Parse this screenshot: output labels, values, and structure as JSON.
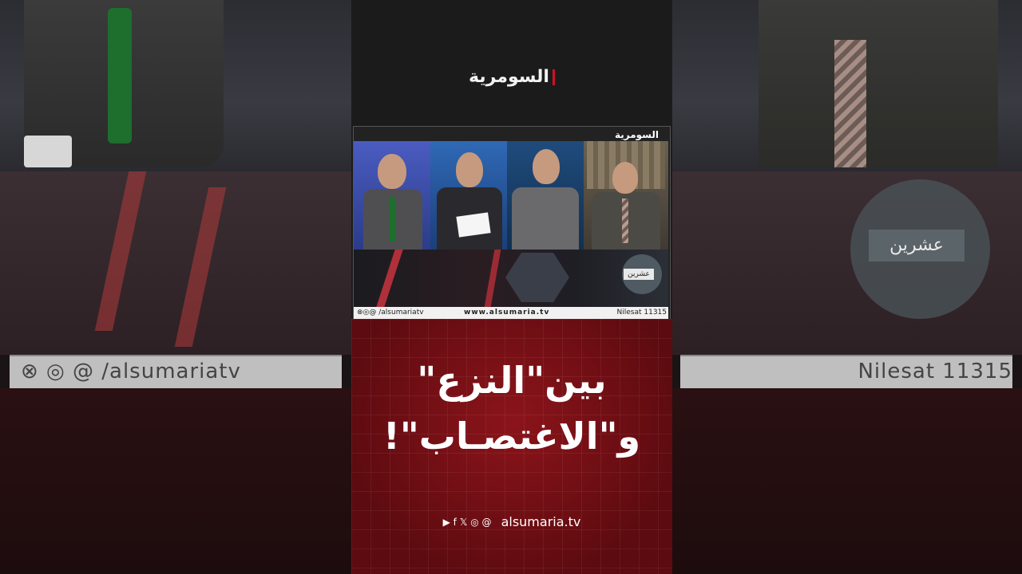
{
  "brand": {
    "logo_text": "السومرية"
  },
  "video": {
    "overlay_logo": "السومرية",
    "program_tag": "عشرين",
    "ticker": {
      "handle": "⊗◎@ /alsumariatv",
      "url": "www.alsumaria.tv",
      "satellite": "Nilesat 11315"
    }
  },
  "headline": {
    "line1": "بين\"النزع\"",
    "line2": "و\"الاغتصـاب\"!"
  },
  "footer": {
    "icons": [
      "youtube-icon",
      "facebook-icon",
      "x-icon",
      "instagram-icon",
      "threads-icon"
    ],
    "icon_glyphs": "▶ f 𝕏 ◎ @",
    "site": "alsumaria.tv"
  },
  "background": {
    "left_strip_text": "⊗ ◎ @ /alsumariatv",
    "right_strip_text": "Nilesat  11315",
    "right_program_tag": "عشرين"
  },
  "colors": {
    "accent_red": "#d0102a",
    "panel_red": "#6e0f13"
  }
}
